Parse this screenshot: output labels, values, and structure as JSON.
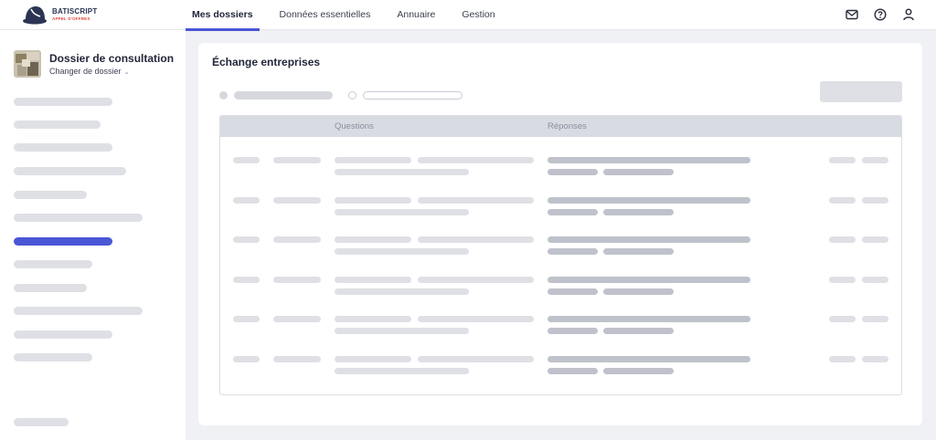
{
  "brand": {
    "name": "BATISCRIPT",
    "subtitle": "APPEL D'OFFRES",
    "colors": {
      "primary": "#4a56d6",
      "dark": "#2b3553",
      "accent": "#e0463c"
    }
  },
  "nav": {
    "tabs": [
      {
        "label": "Mes dossiers",
        "active": true
      },
      {
        "label": "Données essentielles",
        "active": false
      },
      {
        "label": "Annuaire",
        "active": false
      },
      {
        "label": "Gestion",
        "active": false
      }
    ],
    "icons": [
      "mail-icon",
      "help-icon",
      "user-icon"
    ]
  },
  "sidebar": {
    "dossier_title": "Dossier de consultation",
    "change_label": "Changer de dossier",
    "change_icon": "chevron-down-icon",
    "active_item_index": 6
  },
  "main": {
    "title": "Échange entreprises",
    "table": {
      "columns": [
        "",
        "",
        "Questions",
        "Réponses",
        ""
      ]
    }
  }
}
